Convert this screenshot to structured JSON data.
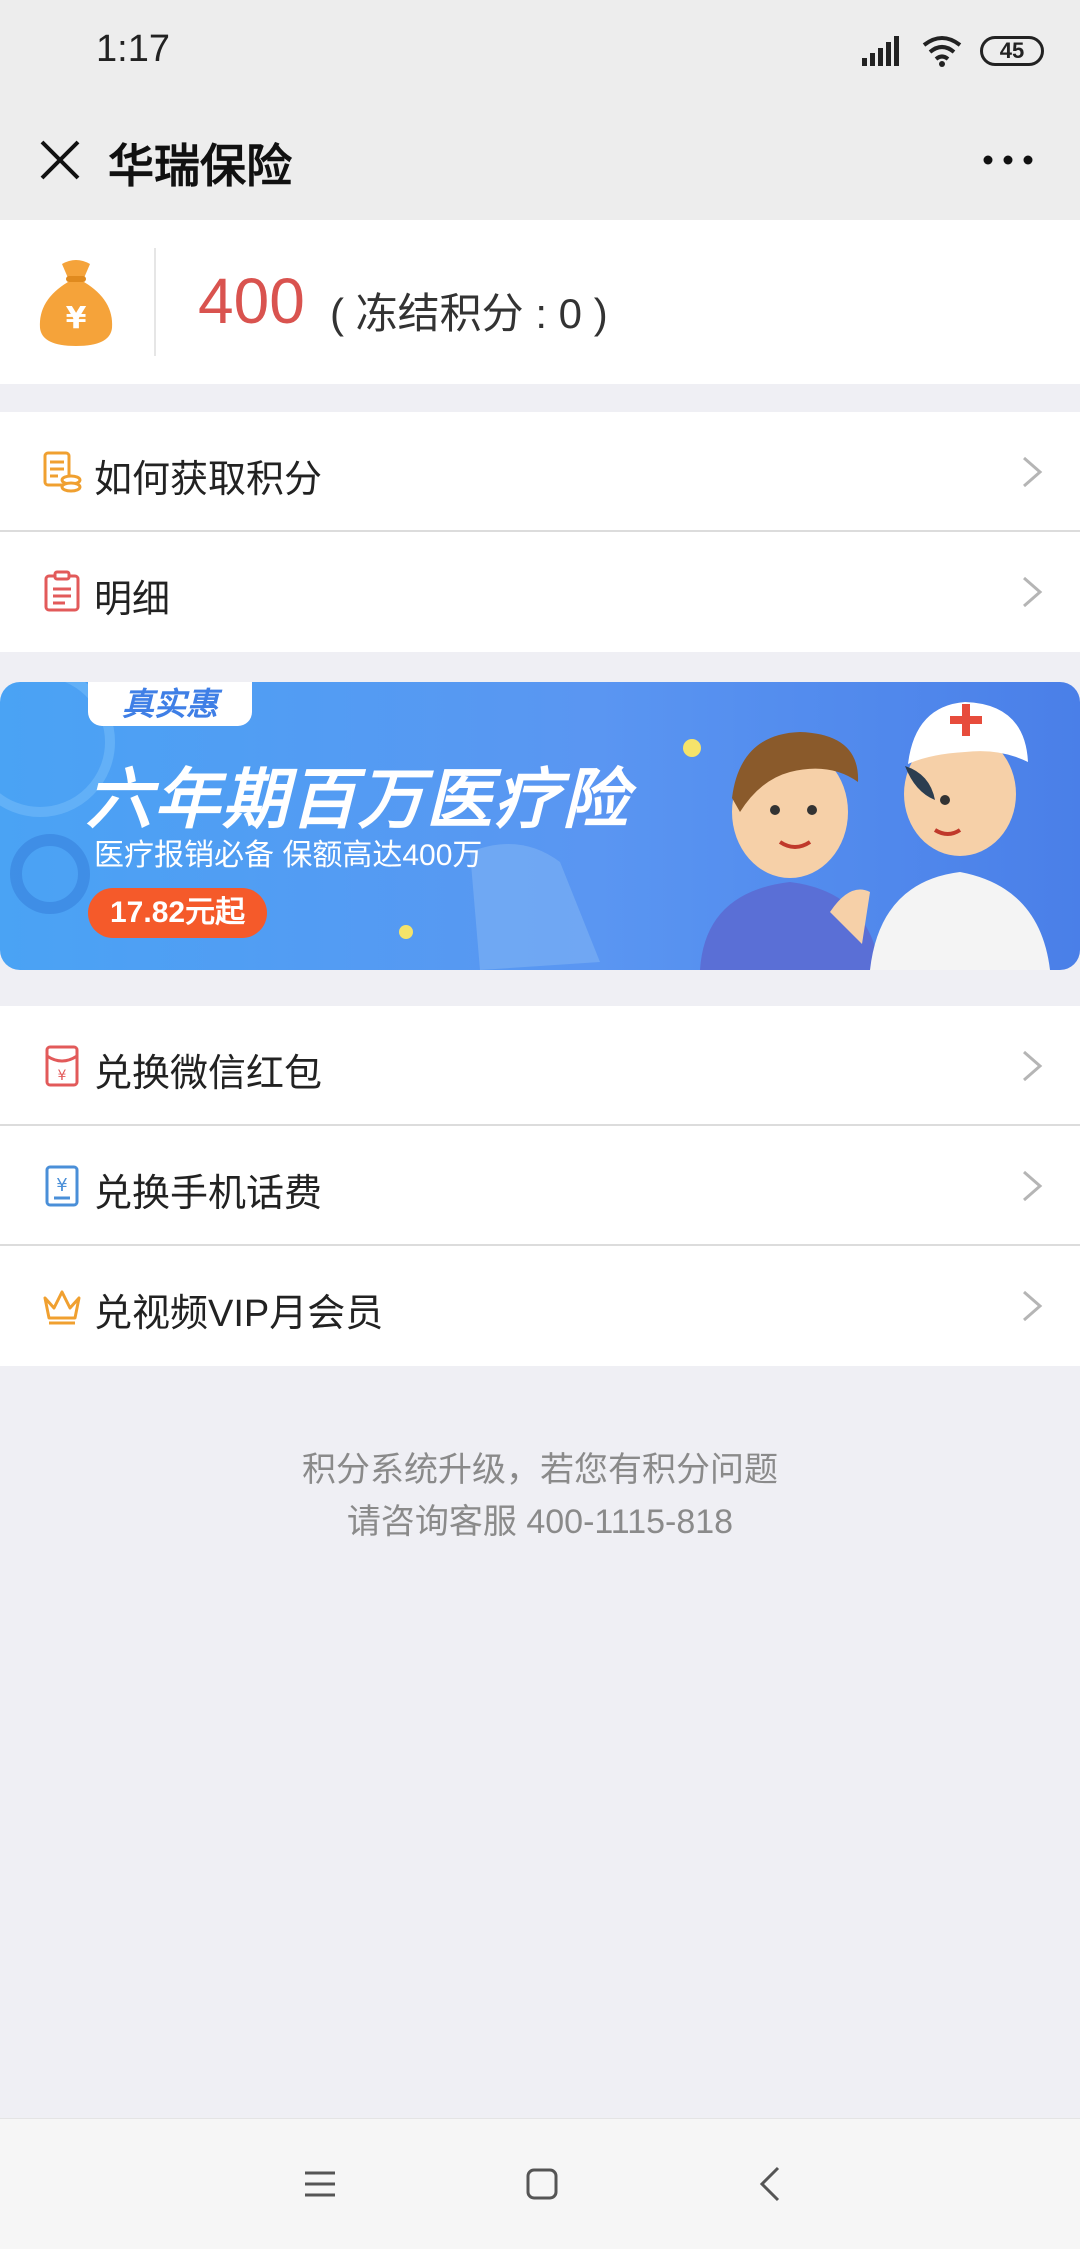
{
  "status_bar": {
    "time": "1:17",
    "battery": "45"
  },
  "header": {
    "title": "华瑞保险"
  },
  "points": {
    "value": "400",
    "frozen_text": "( 冻结积分 : 0 )"
  },
  "menu_top": [
    {
      "label": "如何获取积分",
      "icon": "coins-icon"
    },
    {
      "label": "明细",
      "icon": "clipboard-icon"
    }
  ],
  "banner": {
    "tag": "真实惠",
    "title": "六年期百万医疗险",
    "subtitle": "医疗报销必备   保额高达400万",
    "price": "17.82元起"
  },
  "menu_exchange": [
    {
      "label": "兑换微信红包",
      "icon": "red-envelope-icon"
    },
    {
      "label": "兑换手机话费",
      "icon": "phone-bill-icon"
    },
    {
      "label": "兑视频VIP月会员",
      "icon": "crown-icon"
    }
  ],
  "footer_note": {
    "line1": "积分系统升级，若您有积分问题",
    "line2": "请咨询客服 400-1115-818"
  },
  "colors": {
    "points": "#d9534f",
    "banner": "#4f93f0",
    "price_pill": "#f55a2a"
  }
}
